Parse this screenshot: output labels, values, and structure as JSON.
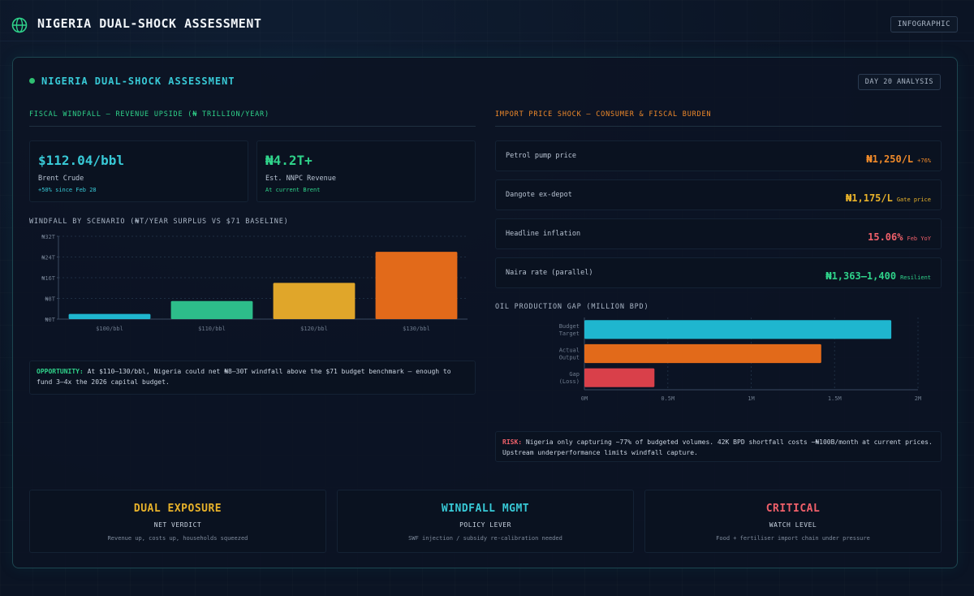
{
  "header": {
    "title": "NIGERIA DUAL-SHOCK ASSESSMENT",
    "badge": "INFOGRAPHIC"
  },
  "card": {
    "title": "NIGERIA DUAL-SHOCK ASSESSMENT",
    "badge": "DAY 20 ANALYSIS"
  },
  "fiscal": {
    "title": "FISCAL WINDFALL — REVENUE UPSIDE (₦ TRILLION/YEAR)",
    "kpis": [
      {
        "value": "$112.04/bbl",
        "label": "Brent Crude",
        "sub": "+50% since Feb 28",
        "color": "#38c9d6"
      },
      {
        "value": "₦4.2T+",
        "label": "Est. NNPC Revenue",
        "sub": "At current Brent",
        "color": "#2fd28a"
      }
    ],
    "note_key": "OPPORTUNITY:",
    "note_text": " At $110–130/bbl, Nigeria could net ₦8–30T windfall above the $71 budget benchmark — enough to fund 3–4x the 2026 capital budget."
  },
  "import": {
    "title": "IMPORT PRICE SHOCK — CONSUMER & FISCAL BURDEN",
    "rows": [
      {
        "label": "Petrol pump price",
        "value": "₦1,250/L",
        "tag": "+76%",
        "color": "#f08a2a"
      },
      {
        "label": "Dangote ex-depot",
        "value": "₦1,175/L",
        "tag": "Gate price",
        "color": "#e8b22a"
      },
      {
        "label": "Headline inflation",
        "value": "15.06%",
        "tag": "Feb YoY",
        "color": "#f0606a"
      },
      {
        "label": "Naira rate (parallel)",
        "value": "₦1,363–1,400",
        "tag": "Resilient",
        "color": "#2fd28a"
      }
    ],
    "note_key": "RISK:",
    "note_text": " Nigeria only capturing ~77% of budgeted volumes. 42K BPD shortfall costs ~₦100B/month at current prices. Upstream underperformance limits windfall capture."
  },
  "chart_data": [
    {
      "type": "bar",
      "title": "WINDFALL BY SCENARIO (₦T/YEAR SURPLUS VS $71 BASELINE)",
      "categories": [
        "$100/bbl",
        "$110/bbl",
        "$120/bbl",
        "$130/bbl"
      ],
      "values": [
        2,
        7,
        14,
        26
      ],
      "colors": [
        "#1fb6cf",
        "#2dbd8a",
        "#e0a62a",
        "#e26a1a"
      ],
      "ylim": [
        0,
        32
      ],
      "yticks": [
        0,
        8,
        16,
        24,
        32
      ],
      "ytick_labels": [
        "₦0T",
        "₦8T",
        "₦16T",
        "₦24T",
        "₦32T"
      ],
      "grid": true
    },
    {
      "type": "bar",
      "orientation": "horizontal",
      "title": "OIL PRODUCTION GAP (MILLION BPD)",
      "categories": [
        [
          "Budget",
          "Target"
        ],
        [
          "Actual",
          "Output"
        ],
        [
          "Gap",
          "(Loss)"
        ]
      ],
      "values": [
        1.84,
        1.42,
        0.42
      ],
      "colors": [
        "#1fb6cf",
        "#e26a1a",
        "#d9404a"
      ],
      "xlim": [
        0,
        2
      ],
      "xticks": [
        0,
        0.5,
        1,
        1.5,
        2
      ],
      "xtick_labels": [
        "0M",
        "0.5M",
        "1M",
        "1.5M",
        "2M"
      ],
      "grid": true
    }
  ],
  "bottom": [
    {
      "head": "DUAL EXPOSURE",
      "sub": "NET VERDICT",
      "desc": "Revenue up, costs up, households squeezed",
      "color": "#e8b22a"
    },
    {
      "head": "WINDFALL MGMT",
      "sub": "POLICY LEVER",
      "desc": "SWF injection / subsidy re-calibration needed",
      "color": "#38c9d6"
    },
    {
      "head": "CRITICAL",
      "sub": "WATCH LEVEL",
      "desc": "Food + fertiliser import chain under pressure",
      "color": "#f0606a"
    }
  ],
  "colors": {
    "accent": "#38c9d6",
    "green": "#2fd28a",
    "orange": "#f08a2a"
  }
}
